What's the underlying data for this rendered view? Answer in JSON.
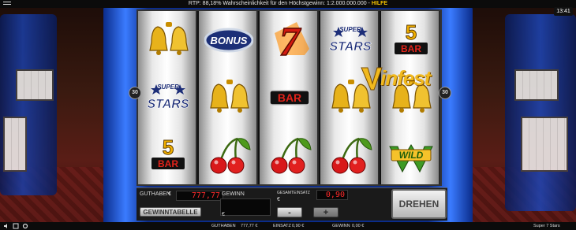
{
  "topbar": {
    "info_prefix": "RTP: 88,18% Wahrscheinlichkeit für den Höchstgewinn: 1:2.000.000.000 -",
    "help_label": "HILFE",
    "clock": "13:41"
  },
  "reels": [
    [
      "bells",
      "super-stars",
      "5-bar"
    ],
    [
      "bonus",
      "bells",
      "cherries"
    ],
    [
      "seven",
      "bar",
      "cherries"
    ],
    [
      "super-stars",
      "bells",
      "cherries"
    ],
    [
      "5-bar",
      "bells",
      "wild"
    ]
  ],
  "symbol_text": {
    "bonus": "BONUS",
    "super": "SUPER",
    "stars": "STARS",
    "five": "5",
    "bar": "BAR",
    "wild": "WILD",
    "seven": "7"
  },
  "paylines": {
    "left": "30",
    "right": "30"
  },
  "watermark": "infest",
  "panel": {
    "credit_label": "GUTHABEN",
    "credit_value": "777,77",
    "credit_currency": "€",
    "win_label": "GEWINN",
    "win_currency": "€",
    "total_bet_label": "GESAMTEINSATZ",
    "total_bet_value": "0,90",
    "bet_currency": "€",
    "paytable_label": "GEWINNTABELLE",
    "minus_label": "-",
    "plus_label": "+",
    "spin_label": "DREHEN"
  },
  "bottombar": {
    "credit_label": "GUTHABEN",
    "credit_value": "777,77 €",
    "bet_label": "EINSATZ",
    "bet_value": "0,90 €",
    "win_label": "GEWINN",
    "win_value": "0,00 €",
    "game_name": "Super 7 Stars"
  },
  "colors": {
    "accent_gold": "#f1b91e",
    "frame_blue": "#0b2c8a",
    "lcd_red": "#ff2a2a",
    "help_yellow": "#f3c200"
  }
}
